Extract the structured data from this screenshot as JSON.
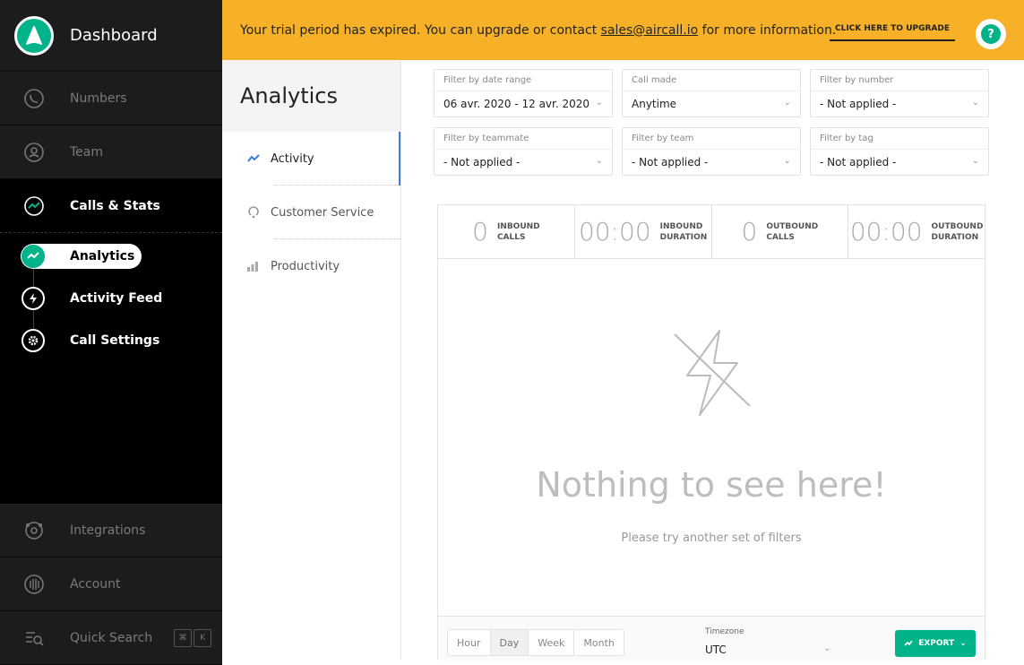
{
  "sidebar": {
    "title": "Dashboard",
    "items": [
      {
        "label": "Numbers",
        "icon": "phone-icon"
      },
      {
        "label": "Team",
        "icon": "user-icon"
      },
      {
        "label": "Calls & Stats",
        "icon": "stats-icon"
      }
    ],
    "sub_items": [
      {
        "label": "Analytics",
        "icon": "analytics-icon"
      },
      {
        "label": "Activity Feed",
        "icon": "lightning-icon"
      },
      {
        "label": "Call Settings",
        "icon": "gear-icon"
      }
    ],
    "bottom_items": [
      {
        "label": "Integrations",
        "icon": "integrations-icon"
      },
      {
        "label": "Account",
        "icon": "fingerprint-icon"
      },
      {
        "label": "Quick Search",
        "icon": "search-icon"
      }
    ],
    "shortcut": [
      "⌘",
      "K"
    ]
  },
  "banner": {
    "text_before": "Your trial period has expired. You can upgrade or contact ",
    "email": "sales@aircall.io",
    "text_after": " for more information.",
    "upgrade_label": "CLICK HERE TO UPGRADE",
    "help_symbol": "?"
  },
  "analytics": {
    "title": "Analytics",
    "tabs": [
      {
        "label": "Activity"
      },
      {
        "label": "Customer Service"
      },
      {
        "label": "Productivity"
      }
    ]
  },
  "filters": [
    {
      "label": "Filter by date range",
      "value": "06 avr. 2020 - 12 avr. 2020"
    },
    {
      "label": "Call made",
      "value": "Anytime"
    },
    {
      "label": "Filter by number",
      "value": "- Not applied -"
    },
    {
      "label": "Filter by teammate",
      "value": "- Not applied -"
    },
    {
      "label": "Filter by team",
      "value": "- Not applied -"
    },
    {
      "label": "Filter by tag",
      "value": "- Not applied -"
    }
  ],
  "stats": [
    {
      "value": "0",
      "caption1": "INBOUND",
      "caption2": "CALLS"
    },
    {
      "value": "00:00",
      "caption1": "INBOUND",
      "caption2": "DURATION"
    },
    {
      "value": "0",
      "caption1": "OUTBOUND",
      "caption2": "CALLS"
    },
    {
      "value": "00:00",
      "caption1": "OUTBOUND",
      "caption2": "DURATION"
    }
  ],
  "empty": {
    "title": "Nothing to see here!",
    "subtitle": "Please try another set of filters"
  },
  "footer": {
    "granularity": [
      "Hour",
      "Day",
      "Week",
      "Month"
    ],
    "selected_granularity": "Day",
    "timezone_label": "Timezone",
    "timezone_value": "UTC",
    "export_label": "EXPORT"
  },
  "colors": {
    "accent": "#00b388",
    "banner": "#f7b128",
    "active_tab": "#3b7ddd"
  }
}
